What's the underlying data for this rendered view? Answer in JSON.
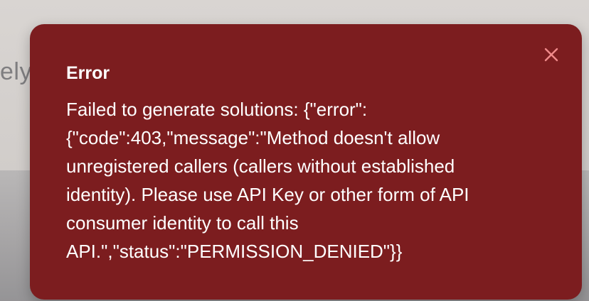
{
  "background": {
    "fragment_text": "ely"
  },
  "toast": {
    "title": "Error",
    "message_lines": [
      "Failed to generate solutions: {\"error\":",
      "{\"code\":403,\"message\":\"Method doesn't allow",
      "unregistered callers (callers without established",
      "identity). Please use API Key or other form of API",
      "consumer identity to call this",
      "API.\",\"status\":\"PERMISSION_DENIED\"}}"
    ],
    "close_icon": "close-icon",
    "colors": {
      "background": "#7c1d1f",
      "text": "#ffffff",
      "close_icon": "#f08a8a"
    }
  }
}
